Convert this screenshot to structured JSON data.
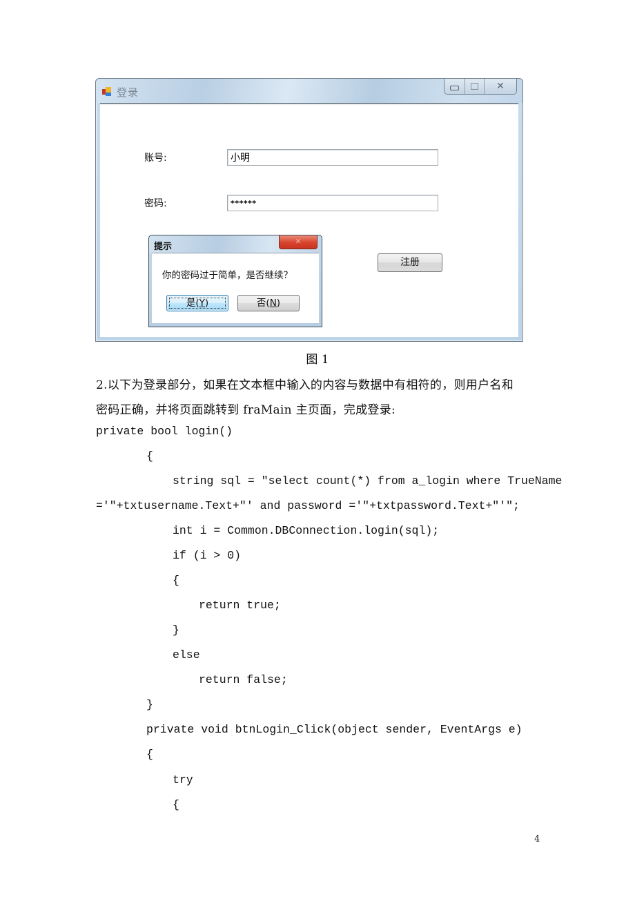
{
  "figure": {
    "window": {
      "title": "登录",
      "icon": "app-window-icon",
      "controls": {
        "minimize": "minimize-icon",
        "maximize": "maximize-icon",
        "close": "✕"
      },
      "account_label": "账号:",
      "account_value": "小明",
      "password_label": "密码:",
      "password_value": "******",
      "register_button": "注册"
    },
    "message_box": {
      "title": "提示",
      "close": "✕",
      "text": "你的密码过于简单，是否继续？",
      "yes_label": "是",
      "yes_mnemonic": "Y",
      "no_label": "否",
      "no_mnemonic": "N"
    },
    "caption": "图 1"
  },
  "body": {
    "paragraph_line1": "2.以下为登录部分，如果在文本框中输入的内容与数据中有相符的，则用户名和",
    "paragraph_line2": "密码正确，并将页面跳转到 fraMain 主页面，完成登录:",
    "code_lines": [
      "private bool login()",
      "{",
      "string sql = \"select count(*) from a_login where TrueName",
      "='\"+txtusername.Text+\"' and password ='\"+txtpassword.Text+\"'\";",
      "int i = Common.DBConnection.login(sql);",
      "if (i > 0)",
      "{",
      "return true;",
      "}",
      "else",
      "return false;",
      "}",
      "private void btnLogin_Click(object sender, EventArgs e)",
      "{",
      "try",
      "{"
    ]
  },
  "page_number": "4"
}
